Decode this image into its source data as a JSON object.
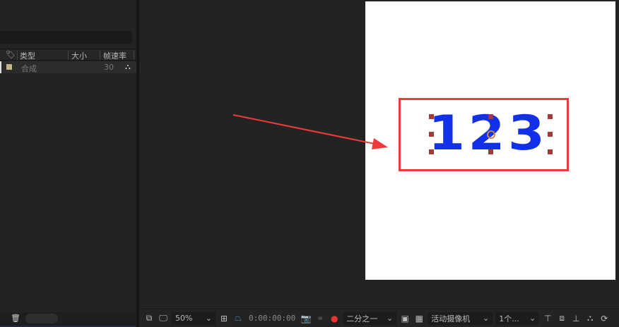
{
  "project_panel": {
    "columns": {
      "type": "类型",
      "size": "大小",
      "fps": "帧速率"
    },
    "rows": [
      {
        "type": "合成",
        "fps": "30",
        "swatch": "#c8b48c"
      }
    ]
  },
  "composition": {
    "text": "123",
    "text_color": "#1230e8",
    "highlight_color": "#f0393a"
  },
  "toolbar": {
    "zoom": "50%",
    "timecode": "0:00:00:00",
    "resolution": "二分之一",
    "camera": "活动摄像机",
    "views": "1个..."
  }
}
